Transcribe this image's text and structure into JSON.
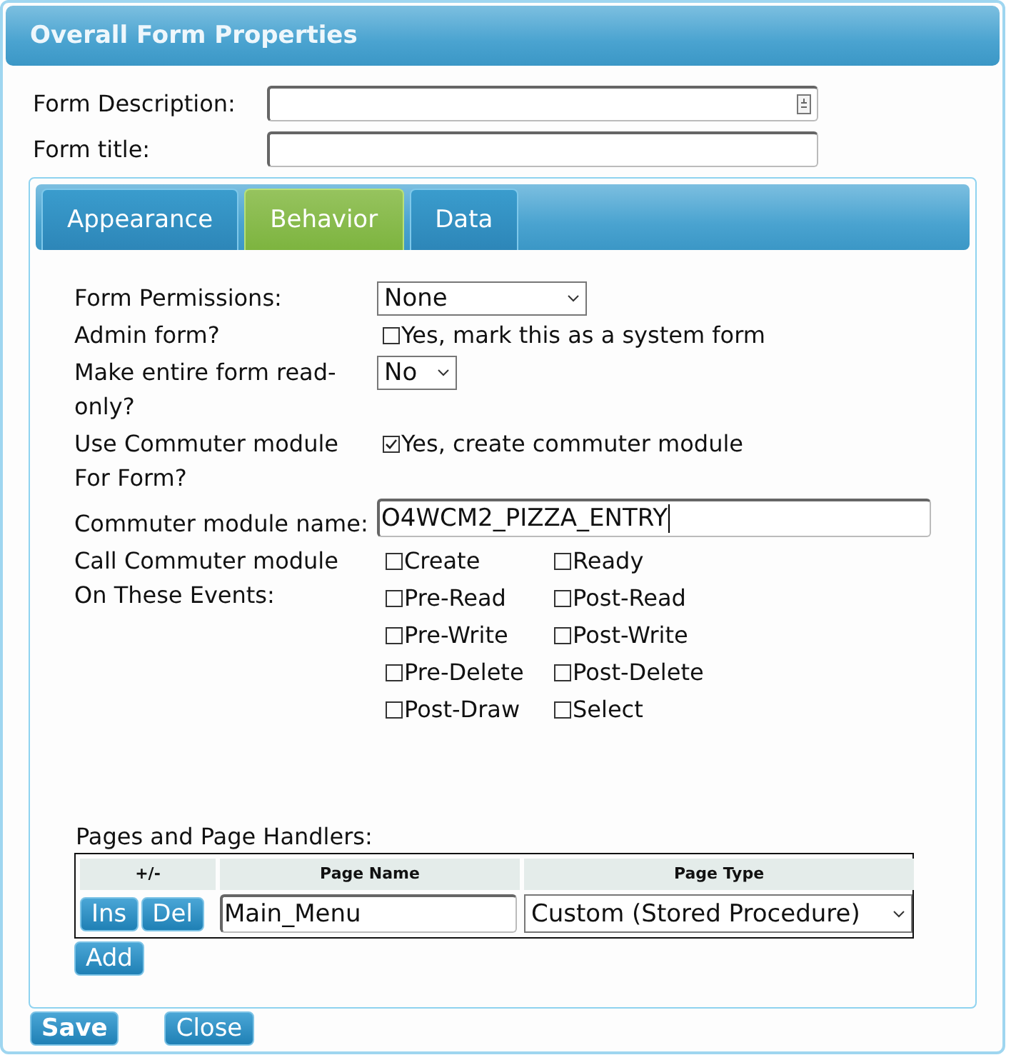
{
  "dialog": {
    "title": "Overall Form Properties"
  },
  "fields": [
    {
      "label": "Form Description:",
      "kind": "memo"
    },
    {
      "label": "Form title:",
      "kind": "text"
    }
  ],
  "tabs": [
    {
      "label": "Appearance",
      "selected": false
    },
    {
      "label": "Behavior",
      "selected": true
    },
    {
      "label": "Data",
      "selected": false
    }
  ],
  "settings": [
    {
      "kind": "select",
      "label": "Form Permissions:",
      "value": "None",
      "wide": true
    },
    {
      "kind": "checkbox",
      "label": "Admin form?",
      "option": "Yes, mark this as a system form",
      "checked": false
    },
    {
      "kind": "select",
      "label": "Make entire form read-only?",
      "value": "No",
      "wide": false
    },
    {
      "kind": "checkbox",
      "label": "Use Commuter module For Form?",
      "option": "Yes, create commuter module",
      "checked": true
    },
    {
      "kind": "text",
      "label": "Commuter module name:",
      "value": "O4WCM2_PIZZA_ENTRY"
    },
    {
      "kind": "events",
      "label": "Call Commuter module On These Events:",
      "events": [
        {
          "label": "Create",
          "checked": false
        },
        {
          "label": "Ready",
          "checked": false
        },
        {
          "label": "Pre-Read",
          "checked": false
        },
        {
          "label": "Post-Read",
          "checked": false
        },
        {
          "label": "Pre-Write",
          "checked": false
        },
        {
          "label": "Post-Write",
          "checked": false
        },
        {
          "label": "Pre-Delete",
          "checked": false
        },
        {
          "label": "Post-Delete",
          "checked": false
        },
        {
          "label": "Post-Draw",
          "checked": false
        },
        {
          "label": "Select",
          "checked": false
        }
      ]
    }
  ],
  "pages": {
    "label": "Pages and Page Handlers:",
    "columns": [
      "+/-",
      "Page Name",
      "Page Type"
    ],
    "rows": [
      {
        "buttons": [
          "Ins",
          "Del"
        ],
        "page_name": "Main_Menu",
        "page_type": "Custom (Stored Procedure)"
      }
    ],
    "add_button": "Add"
  },
  "buttons": [
    {
      "label": "Save",
      "primary": true
    },
    {
      "label": "Close",
      "primary": false
    }
  ]
}
